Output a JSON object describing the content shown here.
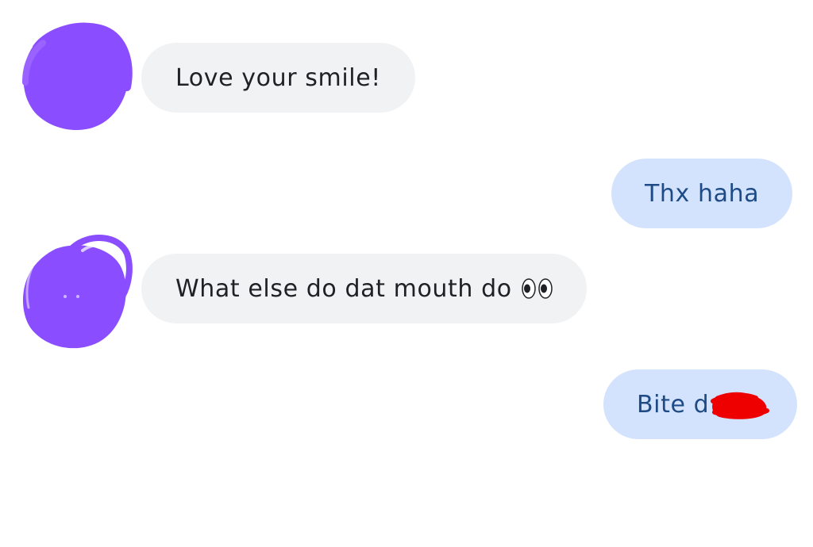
{
  "messages": [
    {
      "direction": "incoming",
      "text": "Love your smile!"
    },
    {
      "direction": "outgoing",
      "text": "Thx haha"
    },
    {
      "direction": "incoming",
      "text": "What else do dat mouth do",
      "trailing_icon": "eyes-emoji-icon"
    },
    {
      "direction": "outgoing",
      "text": "Bite d",
      "redacted_tail": true
    }
  ],
  "colors": {
    "incoming_bubble": "#f1f2f4",
    "incoming_text": "#202124",
    "outgoing_bubble": "#d3e3fd",
    "outgoing_text": "#1e4b86",
    "avatar_scribble": "#8a4dff",
    "redaction_scribble": "#ee0000"
  }
}
